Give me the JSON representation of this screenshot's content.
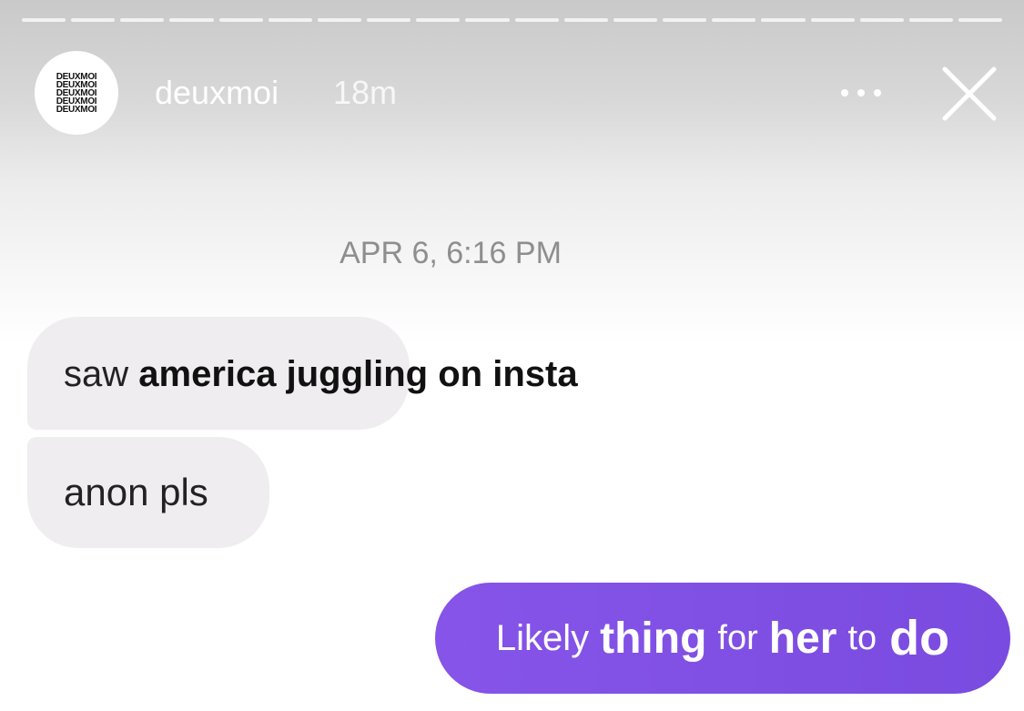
{
  "story_header": {
    "avatar_logo_lines": [
      "DEUXMOI",
      "DEUXMOI",
      "DEUXMOI",
      "DEUXMOI",
      "DEUXMOI"
    ],
    "username": "deuxmoi",
    "time_ago": "18m",
    "more_icon": "ellipsis-icon",
    "close_icon": "close-icon",
    "progress_segments": 20
  },
  "chat": {
    "timestamp": "APR 6, 6:16 PM",
    "incoming": [
      {
        "parts": [
          {
            "text": "saw",
            "weight": "normal"
          },
          {
            "text": "america juggling on insta",
            "weight": "bold"
          }
        ]
      },
      {
        "parts": [
          {
            "text": "anon pls",
            "weight": "normal"
          }
        ]
      }
    ],
    "outgoing": {
      "words": [
        "Likely",
        "thing",
        "for",
        "her",
        "to",
        "do"
      ]
    }
  },
  "colors": {
    "incoming_bubble": "#efedef",
    "outgoing_bubble": "#7d4de3",
    "timestamp_text": "#8e8e8e"
  }
}
